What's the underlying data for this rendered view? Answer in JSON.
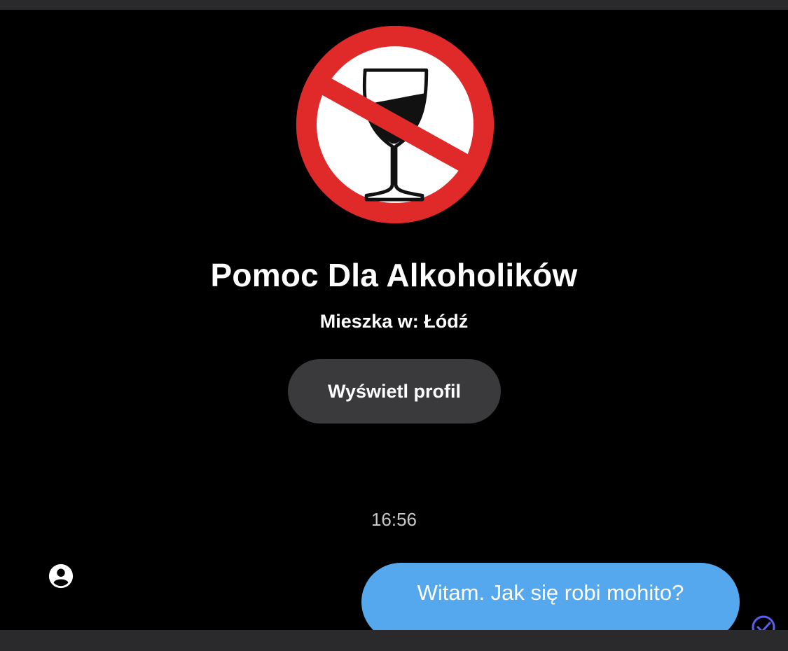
{
  "profile": {
    "avatar_icon": "no-alcohol-sign-icon",
    "name": "Pomoc Dla Alkoholików",
    "location": "Mieszka w: Łódź",
    "view_profile_label": "Wyświetl profil"
  },
  "conversation": {
    "timestamp": "16:56",
    "messages": [
      {
        "direction": "outgoing",
        "text": "Witam. Jak się robi mohito?",
        "status_icon": "sent-check-icon"
      }
    ],
    "other_user_icon": "user-avatar-icon"
  },
  "colors": {
    "background": "#000000",
    "outgoing_bubble": "#56a8ee",
    "button_background": "#3a3a3c",
    "prohibition_red": "#e02a2a",
    "sent_icon": "#5b5ff0"
  }
}
